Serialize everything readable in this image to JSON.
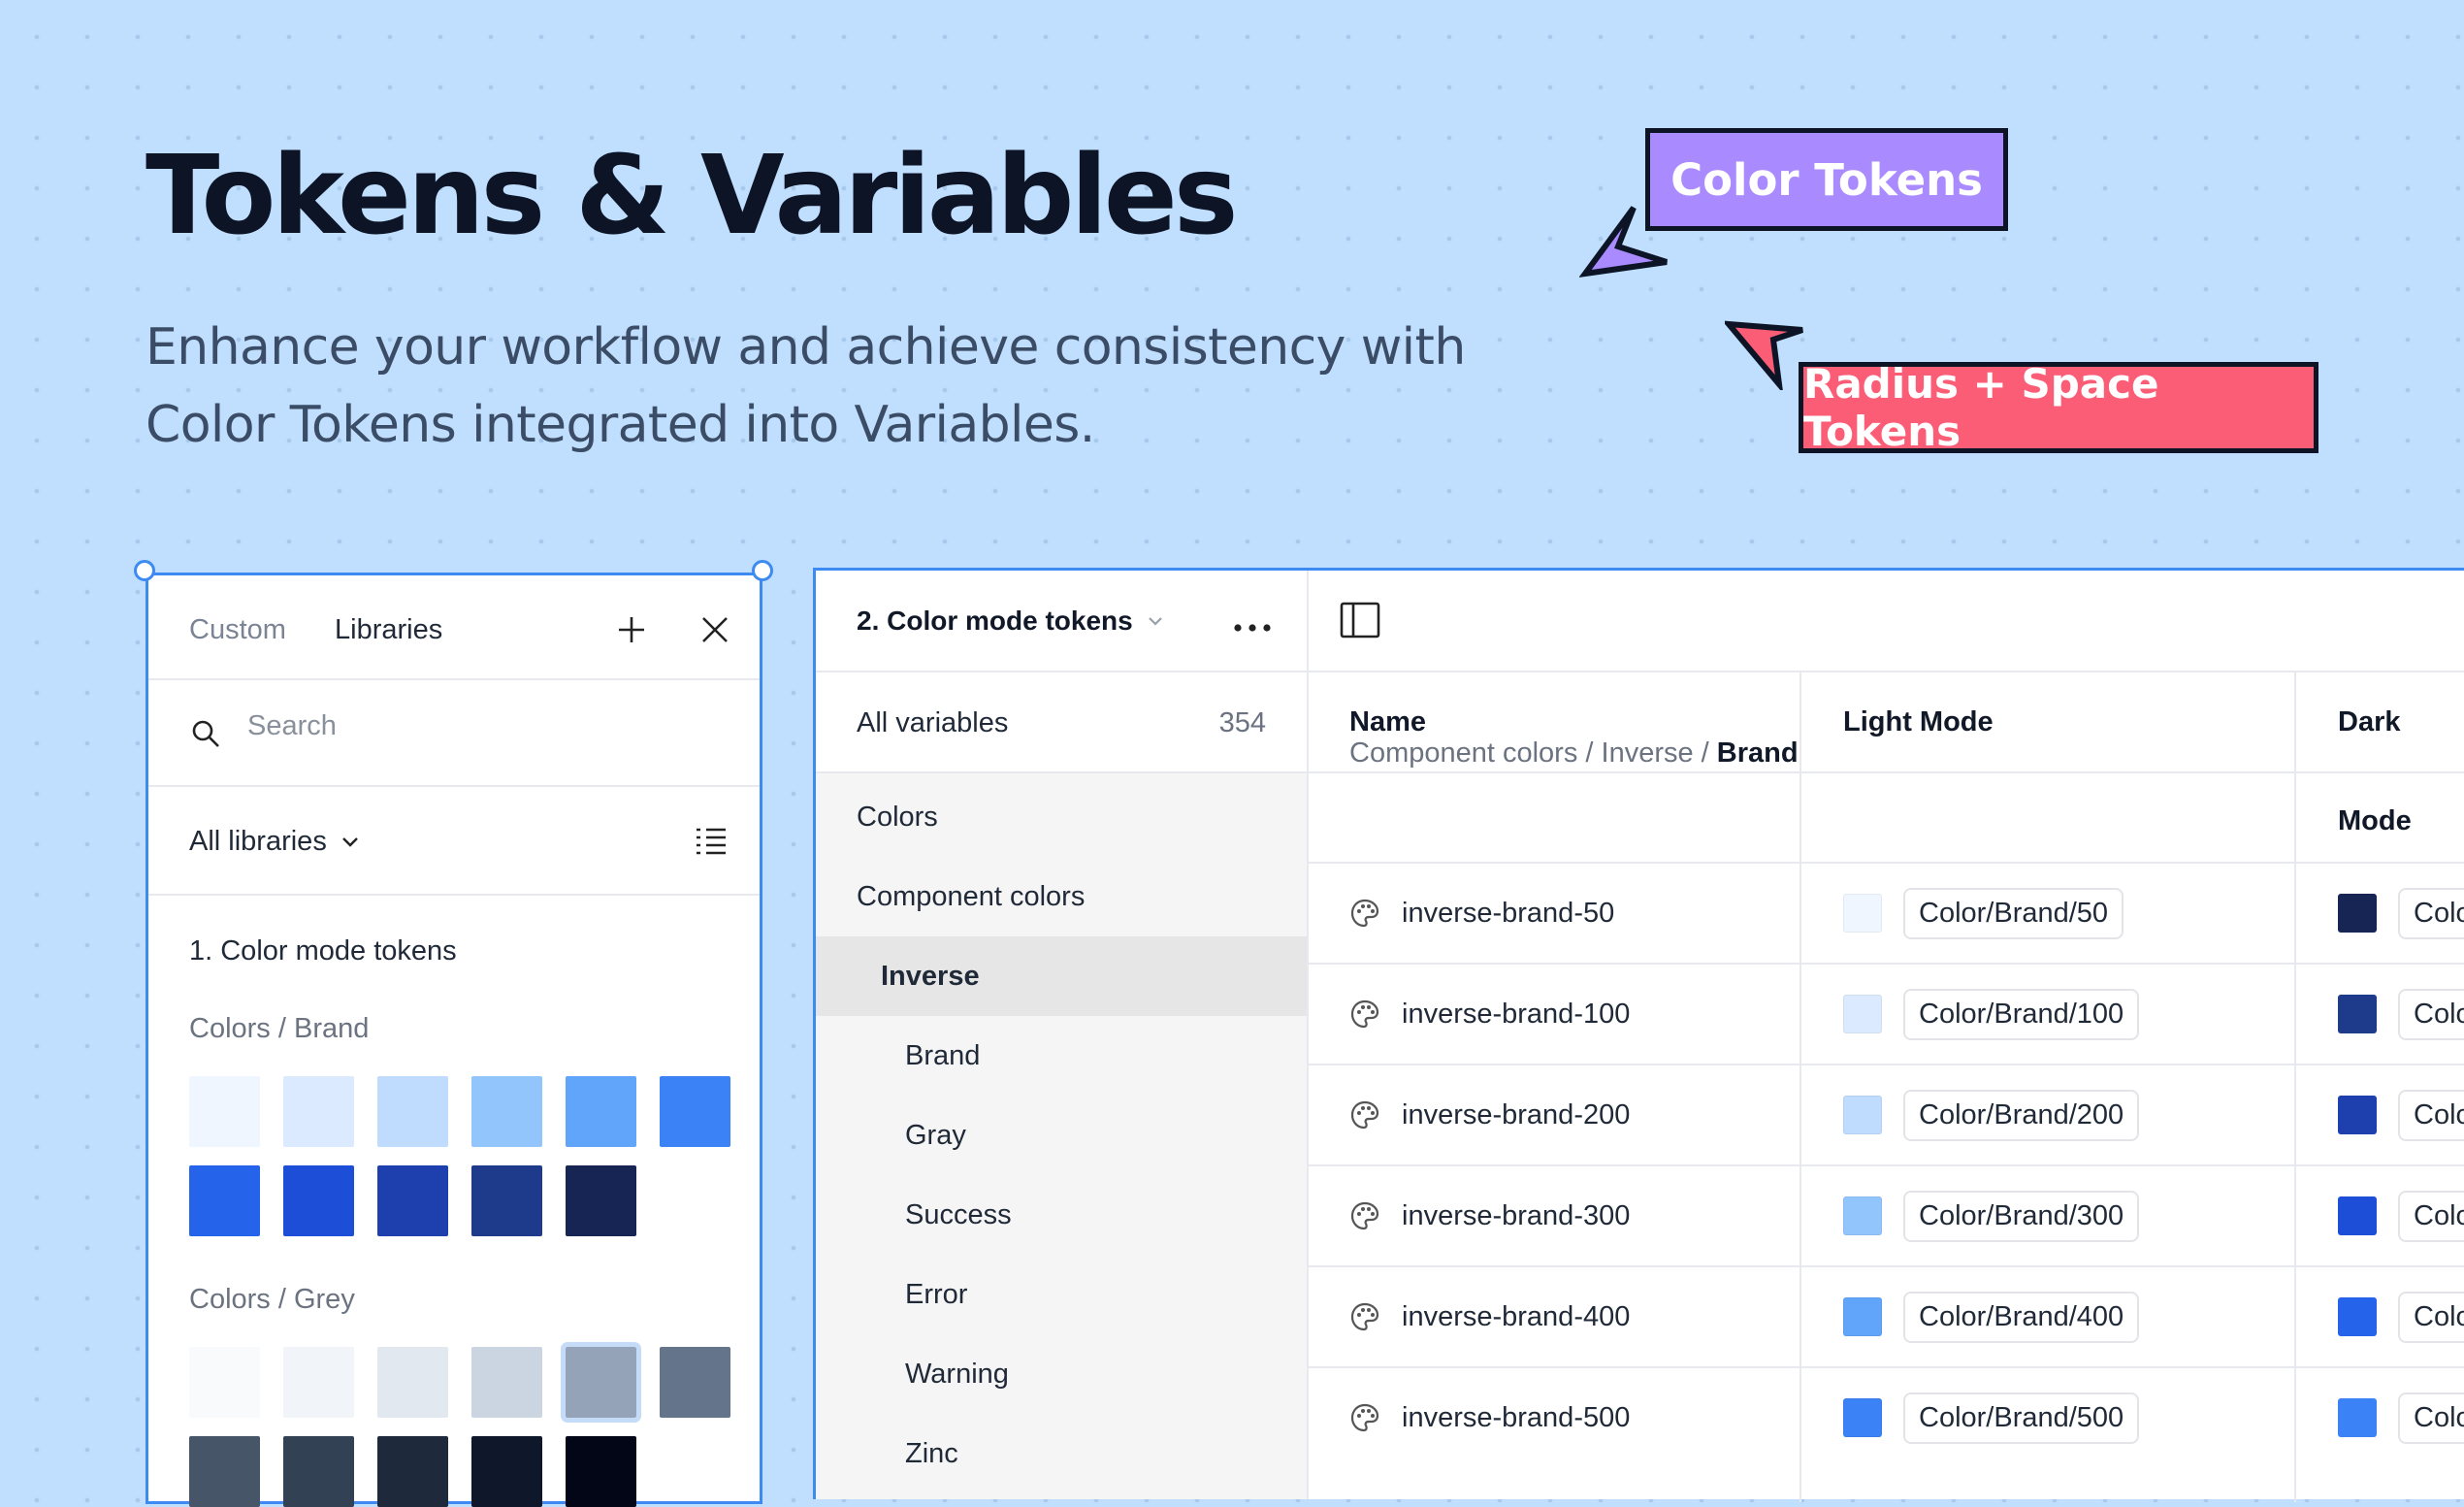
{
  "hero": {
    "title": "Tokens & Variables",
    "subtitle": "Enhance your workflow and achieve consistency with Color Tokens integrated into Variables."
  },
  "tags": {
    "color_tokens": "Color Tokens",
    "radius_space_tokens": "Radius + Space Tokens",
    "color_tokens_bg": "#a98bff",
    "radius_space_bg": "#fb5d76"
  },
  "libraries_panel": {
    "tabs": [
      "Custom",
      "Libraries"
    ],
    "search_placeholder": "Search",
    "filter_label": "All libraries",
    "library_name": "1. Color mode tokens",
    "groups": [
      {
        "title": "Colors / Brand",
        "swatches": [
          "#eff6ff",
          "#dbeafe",
          "#bfdbfe",
          "#93c5fd",
          "#60a5fa",
          "#3b82f6",
          "#2563eb",
          "#1d4ed8",
          "#1e40af",
          "#1e3a8a",
          "#172554"
        ]
      },
      {
        "title": "Colors / Grey",
        "swatches": [
          "#f8fafc",
          "#f1f5f9",
          "#e2e8f0",
          "#cbd5e1",
          "#94a3b8",
          "#64748b",
          "#475569",
          "#334155",
          "#1e293b",
          "#0f172a",
          "#020617"
        ],
        "selected_index": 4
      }
    ]
  },
  "variables_panel": {
    "collection": "2. Color mode tokens",
    "all_variables_label": "All variables",
    "all_variables_count": "354",
    "sidebar_items": [
      {
        "label": "Colors",
        "level": 0
      },
      {
        "label": "Component colors",
        "level": 0
      },
      {
        "label": "Inverse",
        "level": 1,
        "active": true
      },
      {
        "label": "Brand",
        "level": 2
      },
      {
        "label": "Gray",
        "level": 2
      },
      {
        "label": "Success",
        "level": 2
      },
      {
        "label": "Error",
        "level": 2
      },
      {
        "label": "Warning",
        "level": 2
      },
      {
        "label": "Zinc",
        "level": 2
      }
    ],
    "columns": [
      "Name",
      "Light Mode",
      "Dark Mode"
    ],
    "breadcrumb": {
      "path": "Component colors / Inverse / ",
      "current": "Brand"
    },
    "rows": [
      {
        "name": "inverse-brand-50",
        "light_color": "#eff6ff",
        "light_value": "Color/Brand/50",
        "dark_color": "#172554",
        "dark_value": "Colo"
      },
      {
        "name": "inverse-brand-100",
        "light_color": "#dbeafe",
        "light_value": "Color/Brand/100",
        "dark_color": "#1e3a8a",
        "dark_value": "Colo"
      },
      {
        "name": "inverse-brand-200",
        "light_color": "#bfdbfe",
        "light_value": "Color/Brand/200",
        "dark_color": "#1e40af",
        "dark_value": "Colo"
      },
      {
        "name": "inverse-brand-300",
        "light_color": "#93c5fd",
        "light_value": "Color/Brand/300",
        "dark_color": "#1d4ed8",
        "dark_value": "Colo"
      },
      {
        "name": "inverse-brand-400",
        "light_color": "#60a5fa",
        "light_value": "Color/Brand/400",
        "dark_color": "#2563eb",
        "dark_value": "Colo"
      },
      {
        "name": "inverse-brand-500",
        "light_color": "#3b82f6",
        "light_value": "Color/Brand/500",
        "dark_color": "#3b82f6",
        "dark_value": "Colo"
      }
    ]
  }
}
